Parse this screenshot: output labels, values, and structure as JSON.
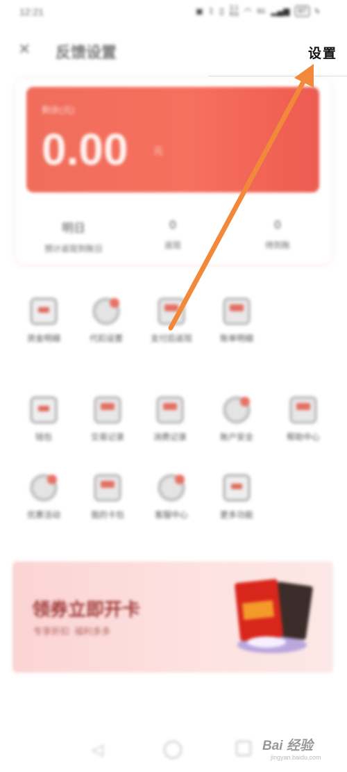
{
  "status_bar": {
    "time": "12:21",
    "net_speed": "2.1\nK/s",
    "network": "5G",
    "battery": "97"
  },
  "header": {
    "title": "反馈设置",
    "close_icon": "close-icon",
    "settings_label": "设置"
  },
  "balance": {
    "label": "剩余(元)",
    "amount": "0.00",
    "unit": "元"
  },
  "stats": [
    {
      "value": "明日",
      "label": "预计返现到账日"
    },
    {
      "value": "0",
      "label": "返现"
    },
    {
      "value": "0",
      "label": "待到账"
    }
  ],
  "grid_row1": [
    {
      "label": "资金明细",
      "icon": "wallet-icon"
    },
    {
      "label": "代扣设置",
      "icon": "clock-icon"
    },
    {
      "label": "支付后返现",
      "icon": "gift-icon"
    },
    {
      "label": "账单明细",
      "icon": "bill-icon"
    }
  ],
  "grid_row2": [
    {
      "label": "钱包",
      "icon": "card-icon"
    },
    {
      "label": "交易记录",
      "icon": "receipt-icon"
    },
    {
      "label": "消费记录",
      "icon": "calendar-icon"
    },
    {
      "label": "账户安全",
      "icon": "shield-icon"
    },
    {
      "label": "帮助中心",
      "icon": "doc-icon"
    }
  ],
  "grid_row3": [
    {
      "label": "优惠活动",
      "icon": "coupon-icon"
    },
    {
      "label": "我的卡包",
      "icon": "wallet-icon"
    },
    {
      "label": "客服中心",
      "icon": "service-icon"
    },
    {
      "label": "更多功能",
      "icon": "more-icon"
    }
  ],
  "banner": {
    "title": "领券立即开卡",
    "subtitle": "专享折扣  福利多多"
  },
  "watermark": {
    "text": "Bai 经验",
    "sub": "jingyan.baidu.com"
  },
  "colors": {
    "card_red": "#f06d5c",
    "arrow_orange": "#f2893a",
    "banner_pink": "#fbd4d3"
  }
}
